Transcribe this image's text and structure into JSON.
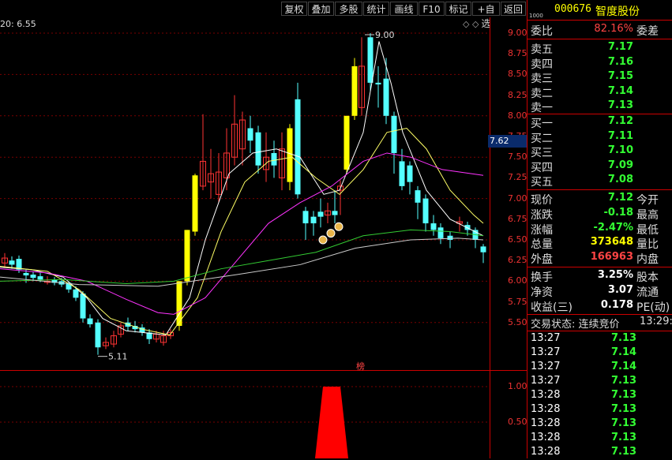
{
  "toolbar": {
    "items": [
      "复权",
      "叠加",
      "多股",
      "统计",
      "画线",
      "F10",
      "标记",
      "+自选",
      "返回"
    ]
  },
  "chart": {
    "ma_label": "20: 6.55",
    "high_label": "9.00",
    "low_label": "5.11",
    "current_price_marker": "7.62",
    "bang_label": "榜",
    "price_ticks": [
      "9.00",
      "8.75",
      "8.50",
      "8.25",
      "8.00",
      "7.75",
      "7.50",
      "7.25",
      "7.00",
      "6.75",
      "6.50",
      "6.25",
      "6.00",
      "5.75",
      "5.50"
    ],
    "volume_ticks": [
      "1.00",
      "0.50"
    ],
    "colors": {
      "up": "#ff3333",
      "down": "#54ffff",
      "limit": "#ffff00",
      "ma5": "#ffffff",
      "ma10": "#ffff66",
      "ma20": "#ff33ff",
      "ma60": "#33cc33",
      "ma120": "#cccccc"
    }
  },
  "quote": {
    "code": "000676",
    "name": "智度股份",
    "tiny_label": "1000",
    "weibi_label": "委比",
    "weibi_value": "82.16%",
    "weicha_label": "委差",
    "asks": [
      {
        "label": "卖五",
        "price": "7.17"
      },
      {
        "label": "卖四",
        "price": "7.16"
      },
      {
        "label": "卖三",
        "price": "7.15"
      },
      {
        "label": "卖二",
        "price": "7.14"
      },
      {
        "label": "卖一",
        "price": "7.13"
      }
    ],
    "bids": [
      {
        "label": "买一",
        "price": "7.12"
      },
      {
        "label": "买二",
        "price": "7.11"
      },
      {
        "label": "买三",
        "price": "7.10"
      },
      {
        "label": "买四",
        "price": "7.09"
      },
      {
        "label": "买五",
        "price": "7.08"
      }
    ],
    "stats": [
      {
        "label": "现价",
        "value": "7.12",
        "label2": "今开",
        "color": "green"
      },
      {
        "label": "涨跌",
        "value": "-0.18",
        "label2": "最高",
        "color": "green"
      },
      {
        "label": "涨幅",
        "value": "-2.47%",
        "label2": "最低",
        "color": "green"
      },
      {
        "label": "总量",
        "value": "373648",
        "label2": "量比",
        "color": "yellow"
      },
      {
        "label": "外盘",
        "value": "166963",
        "label2": "内盘",
        "color": "red"
      }
    ],
    "stats2": [
      {
        "label": "换手",
        "value": "3.25%",
        "label2": "股本",
        "color": "white"
      },
      {
        "label": "净资",
        "value": "3.07",
        "label2": "流通",
        "color": "white"
      },
      {
        "label": "收益(三)",
        "value": "0.178",
        "label2": "PE(动)",
        "color": "white"
      }
    ],
    "trade_status": "交易状态: 连续竞价",
    "trade_time": "13:29:",
    "ticks": [
      {
        "time": "13:27",
        "price": "7.13"
      },
      {
        "time": "13:27",
        "price": "7.14"
      },
      {
        "time": "13:27",
        "price": "7.14"
      },
      {
        "time": "13:27",
        "price": "7.13"
      },
      {
        "time": "13:28",
        "price": "7.13"
      },
      {
        "time": "13:28",
        "price": "7.13"
      },
      {
        "time": "13:28",
        "price": "7.13"
      },
      {
        "time": "13:28",
        "price": "7.13"
      },
      {
        "time": "13:28",
        "price": "7.13"
      }
    ]
  }
}
